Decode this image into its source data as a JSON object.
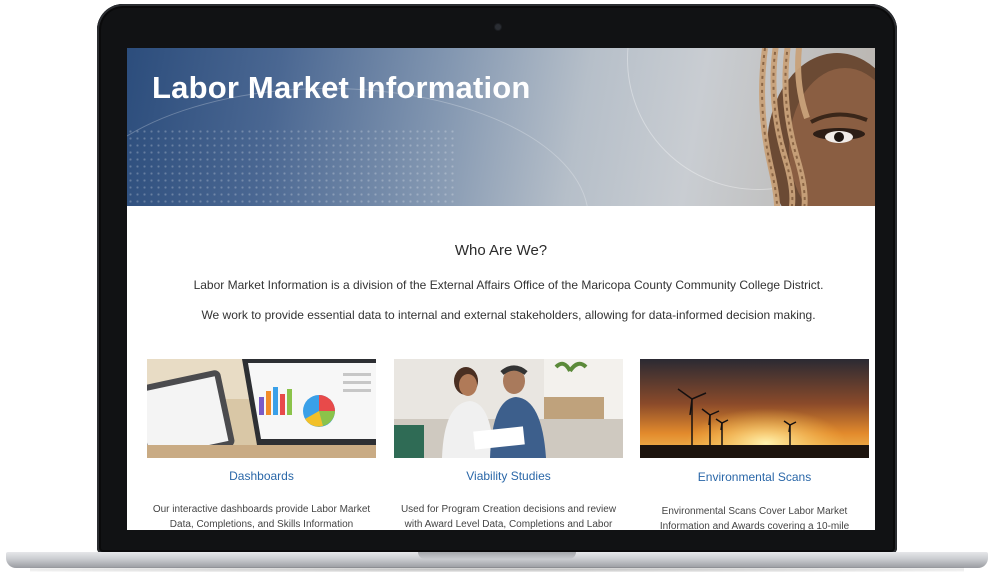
{
  "hero": {
    "title": "Labor Market Information"
  },
  "about": {
    "heading": "Who Are We?",
    "paragraph_1": "Labor Market Information is a division of the External Affairs Office of the Maricopa County Community College District.",
    "paragraph_2": "We work to provide essential data to internal and external stakeholders, allowing for data-informed decision making."
  },
  "cards": [
    {
      "title": "Dashboards",
      "desc_line_1": "Our interactive dashboards provide Labor Market",
      "desc_line_2": "Data, Completions, and Skills Information"
    },
    {
      "title": "Viability Studies",
      "desc_line_1": "Used for Program Creation decisions and review",
      "desc_line_2": "with Award Level Data, Completions and Labor"
    },
    {
      "title": "Environmental Scans",
      "desc_line_1": "Environmental Scans Cover Labor Market",
      "desc_line_2": "Information and Awards covering a 10-mile"
    }
  ],
  "colors": {
    "link_blue": "#2a67a8",
    "hero_blue": "#2c4d7c",
    "bezel": "#111214"
  }
}
